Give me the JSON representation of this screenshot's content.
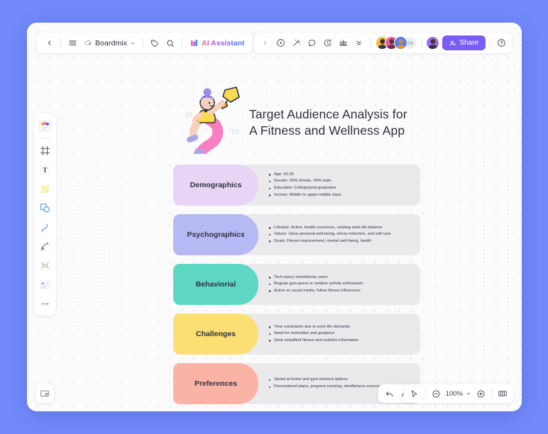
{
  "app": {
    "brand": "Boardmix",
    "ai_assistant": "AI Assistant",
    "share_label": "Share",
    "collaborator_count": "24"
  },
  "topbar": {
    "left_items": [
      {
        "name": "back-button",
        "icon": "chevron-left-icon"
      },
      {
        "name": "menu-button",
        "icon": "hamburger-menu-icon"
      },
      {
        "name": "brand-button",
        "icon": "boardmix-logo-icon"
      },
      {
        "name": "tag-button",
        "icon": "tag-icon"
      },
      {
        "name": "search-button",
        "icon": "search-icon"
      },
      {
        "name": "ai-assistant-button",
        "icon": "ai-sparkle-icon"
      }
    ],
    "right_items": [
      {
        "name": "expand-button",
        "icon": "chevron-right-icon"
      },
      {
        "name": "present-button",
        "icon": "play-circle-icon"
      },
      {
        "name": "magic-button",
        "icon": "magic-wand-icon"
      },
      {
        "name": "comment-button",
        "icon": "comment-bubble-icon"
      },
      {
        "name": "timer-button",
        "icon": "timer-icon"
      },
      {
        "name": "chart-button",
        "icon": "bar-chart-icon"
      },
      {
        "name": "more-button",
        "icon": "chevron-double-down-icon"
      },
      {
        "name": "help-button",
        "icon": "help-circle-icon"
      }
    ]
  },
  "tool_rail": [
    {
      "name": "tool-templates",
      "icon": "templates-icon"
    },
    {
      "name": "tool-frame",
      "icon": "frame-icon"
    },
    {
      "name": "tool-text",
      "icon": "text-icon"
    },
    {
      "name": "tool-sticky-note",
      "icon": "sticky-note-icon"
    },
    {
      "name": "tool-shape",
      "icon": "shapes-icon"
    },
    {
      "name": "tool-connector",
      "icon": "curve-line-icon"
    },
    {
      "name": "tool-pen",
      "icon": "pen-icon"
    },
    {
      "name": "tool-relation",
      "icon": "relation-icon"
    },
    {
      "name": "tool-card",
      "icon": "card-list-icon"
    },
    {
      "name": "tool-more",
      "icon": "more-dots-icon"
    }
  ],
  "board": {
    "title": "Target Audience Analysis for\nA Fitness and Wellness App",
    "illustration": "person-celebrating-with-trophy",
    "rows": [
      {
        "label": "Demographics",
        "color": "#e8d4f5",
        "bullets": [
          "Age: 25-35",
          "Gender: 60% female, 40% male",
          "Education: College/post-graduates",
          "Income: Middle to upper-middle class"
        ]
      },
      {
        "label": "Psychographics",
        "color": "#b7b9f5",
        "bullets": [
          "Lifestyle: Active, health-conscious, seeking work-life balance",
          "Values: Value personal well-being, stress reduction, and self-care",
          "Goals: Fitness improvement, mental well-being, health"
        ]
      },
      {
        "label": "Behaviorial",
        "color": "#5ed7c4",
        "bullets": [
          "Tech-savvy smartphone users",
          "Regular gym-goers or outdoor activity enthusiasts",
          "Active on social media, follow fitness influencers"
        ]
      },
      {
        "label": "Challenges",
        "color": "#fbdf72",
        "bullets": [
          "Time constraints due to work-life demands",
          "Need for motivation and guidance",
          "Seek simplified fitness and nutrition information"
        ]
      },
      {
        "label": "Preferences",
        "color": "#fbb3a5",
        "bullets": [
          "Varied at-home and gym workout options",
          "Personalized plans, progress tracking, mindfulness exercises"
        ]
      }
    ]
  },
  "bottombar": {
    "minimap_icon": "minimap-icon",
    "undo_icon": "undo-arrow-icon",
    "redo_icon": "redo-arrow-icon",
    "cursor_icon": "cursor-pointer-icon",
    "zoom_out_icon": "zoom-out-icon",
    "zoom_in_icon": "zoom-in-icon",
    "zoom_level": "100%",
    "zoom_dropdown_icon": "chevron-down-icon",
    "pages_icon": "pages-icon"
  },
  "colors": {
    "page_background": "#7189fb",
    "accent_purple": "#7b5cf5",
    "row_body_gray": "#eaeaec"
  }
}
